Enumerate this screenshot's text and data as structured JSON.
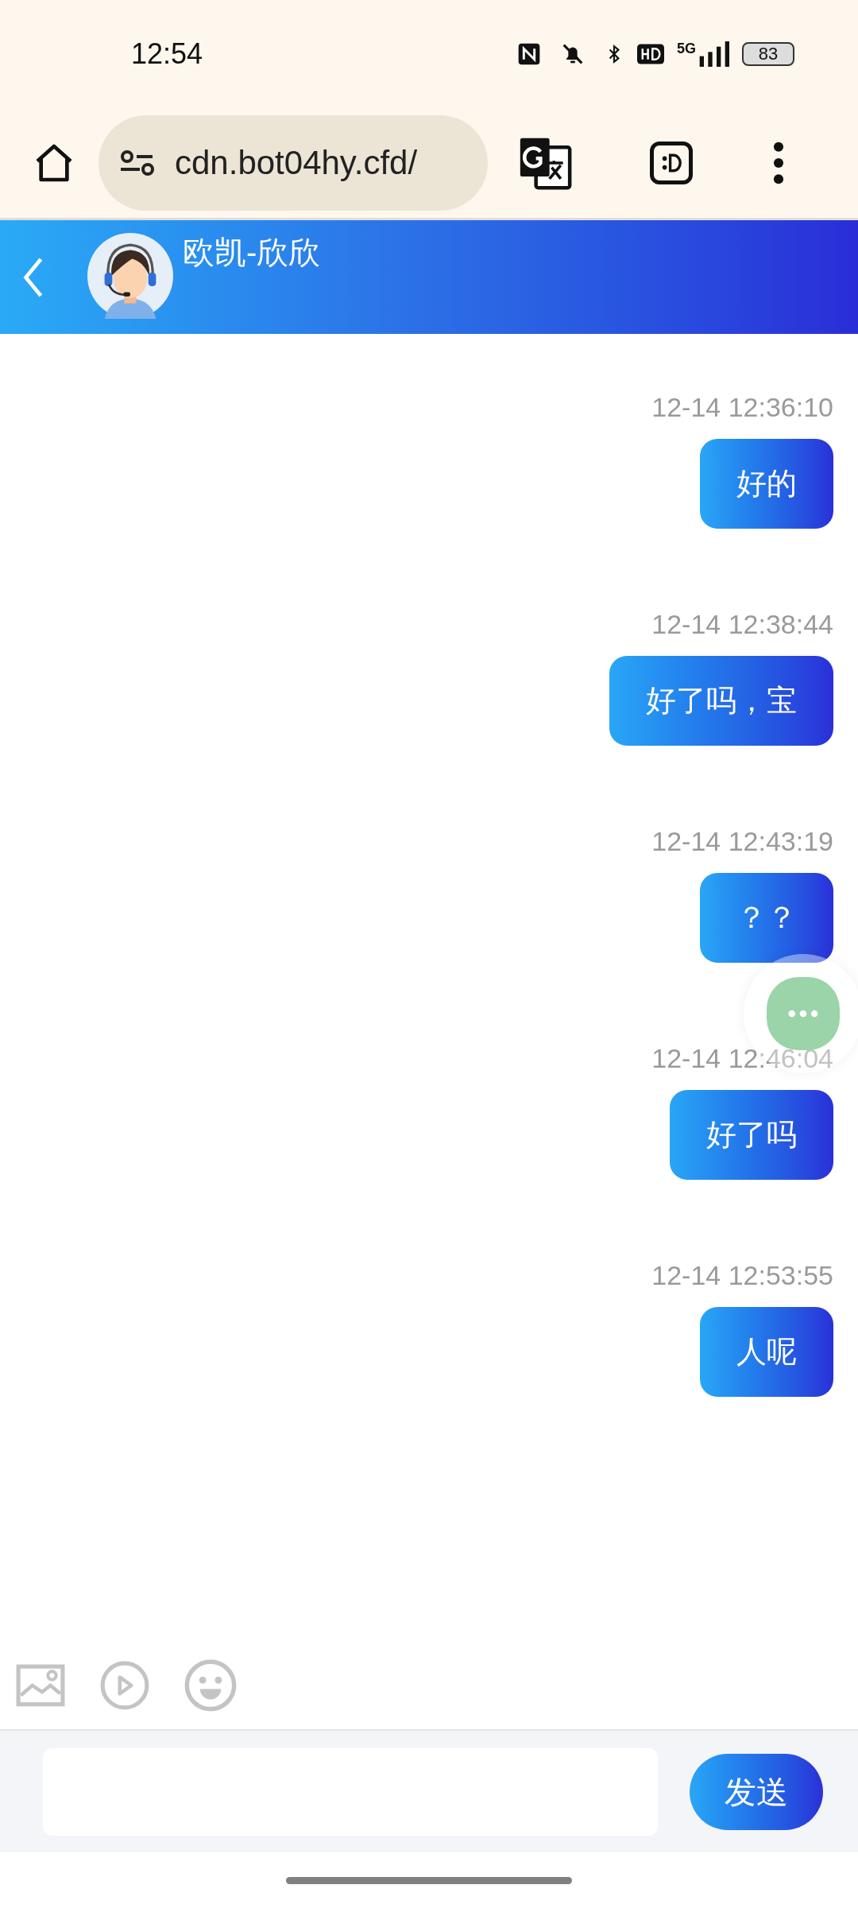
{
  "status_bar": {
    "time": "12:54",
    "battery": "83",
    "network": "5G"
  },
  "browser": {
    "url": "cdn.bot04hy.cfd/"
  },
  "chat_header": {
    "title": "欧凯-欣欣"
  },
  "messages": [
    {
      "time": "12-14 12:36:10",
      "text": "好的",
      "kind": "outgoing"
    },
    {
      "time": "12-14 12:38:44",
      "text": "好了吗，宝",
      "kind": "outgoing"
    },
    {
      "time": "12-14 12:43:19",
      "text": "？？",
      "kind": "outgoing"
    },
    {
      "time": "12-14 12:46:04",
      "text": "好了吗",
      "kind": "outgoing"
    },
    {
      "time": "12-14 12:53:55",
      "text": "人呢",
      "kind": "outgoing"
    }
  ],
  "composer": {
    "send_button": "发送"
  }
}
